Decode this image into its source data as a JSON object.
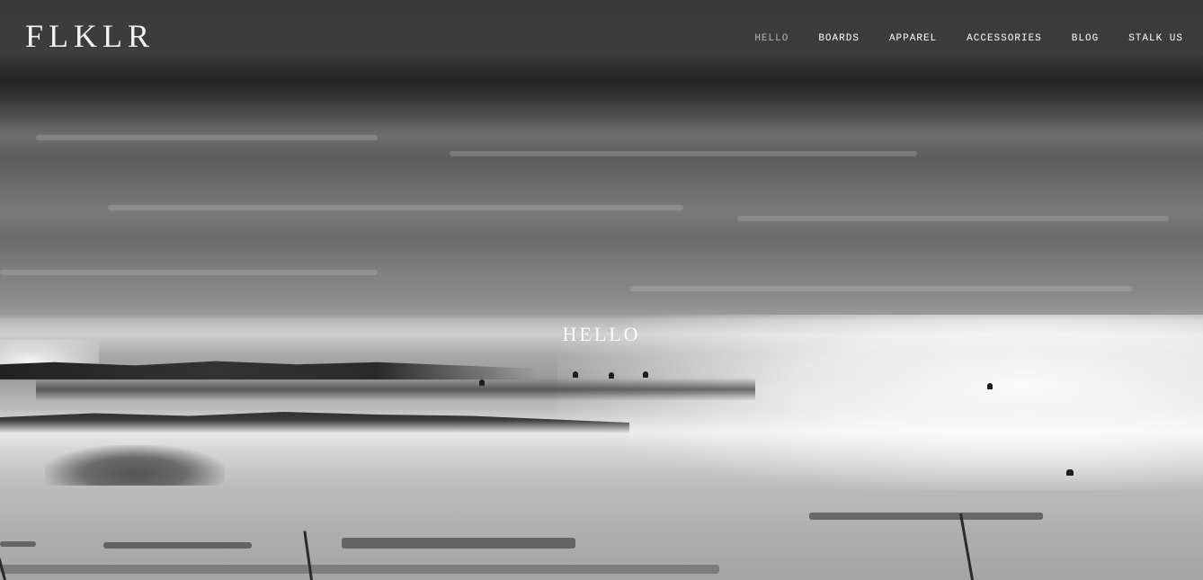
{
  "site": {
    "logo_text": "FLKLR"
  },
  "nav": {
    "items": [
      {
        "label": "HELLO",
        "active": true
      },
      {
        "label": "BOARDS",
        "active": false
      },
      {
        "label": "APPAREL",
        "active": false
      },
      {
        "label": "ACCESSORIES",
        "active": false
      },
      {
        "label": "BLOG",
        "active": false
      },
      {
        "label": "STALK US",
        "active": false
      }
    ]
  },
  "hero": {
    "title": "HELLO",
    "background": "grayscale-beach-photo"
  },
  "colors": {
    "nav_text": "#ffffff",
    "nav_active": "#b4b4b4",
    "logo": "#f2f2f2"
  }
}
